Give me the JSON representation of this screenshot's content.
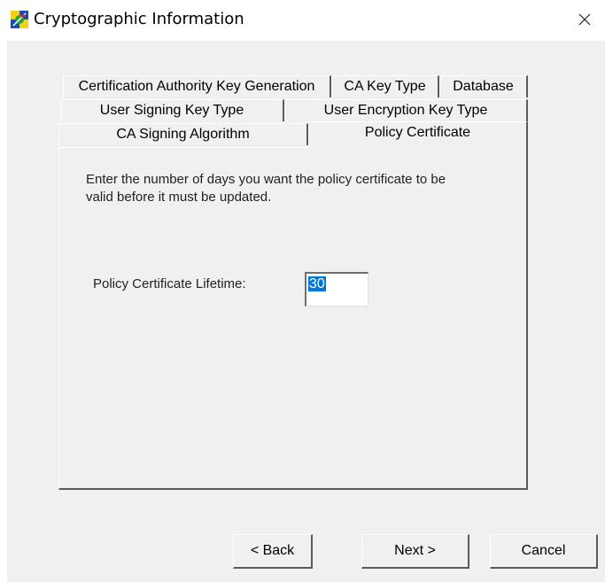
{
  "window": {
    "title": "Cryptographic Information",
    "app_icon": "cert-server-icon",
    "close_icon": "close-icon"
  },
  "tabs": {
    "row1": [
      "Certification Authority Key Generation",
      "CA Key Type",
      "Database"
    ],
    "row2": [
      "User Signing Key Type",
      "User Encryption Key Type"
    ],
    "row3": [
      "CA Signing Algorithm",
      "Policy Certificate"
    ],
    "active": "Policy Certificate"
  },
  "panel": {
    "description": "Enter the number of days you want the policy certificate to be valid before it must be updated.",
    "lifetime_label": "Policy Certificate Lifetime:",
    "lifetime_value": "30"
  },
  "buttons": {
    "back": "< Back",
    "next": "Next >",
    "cancel": "Cancel"
  }
}
